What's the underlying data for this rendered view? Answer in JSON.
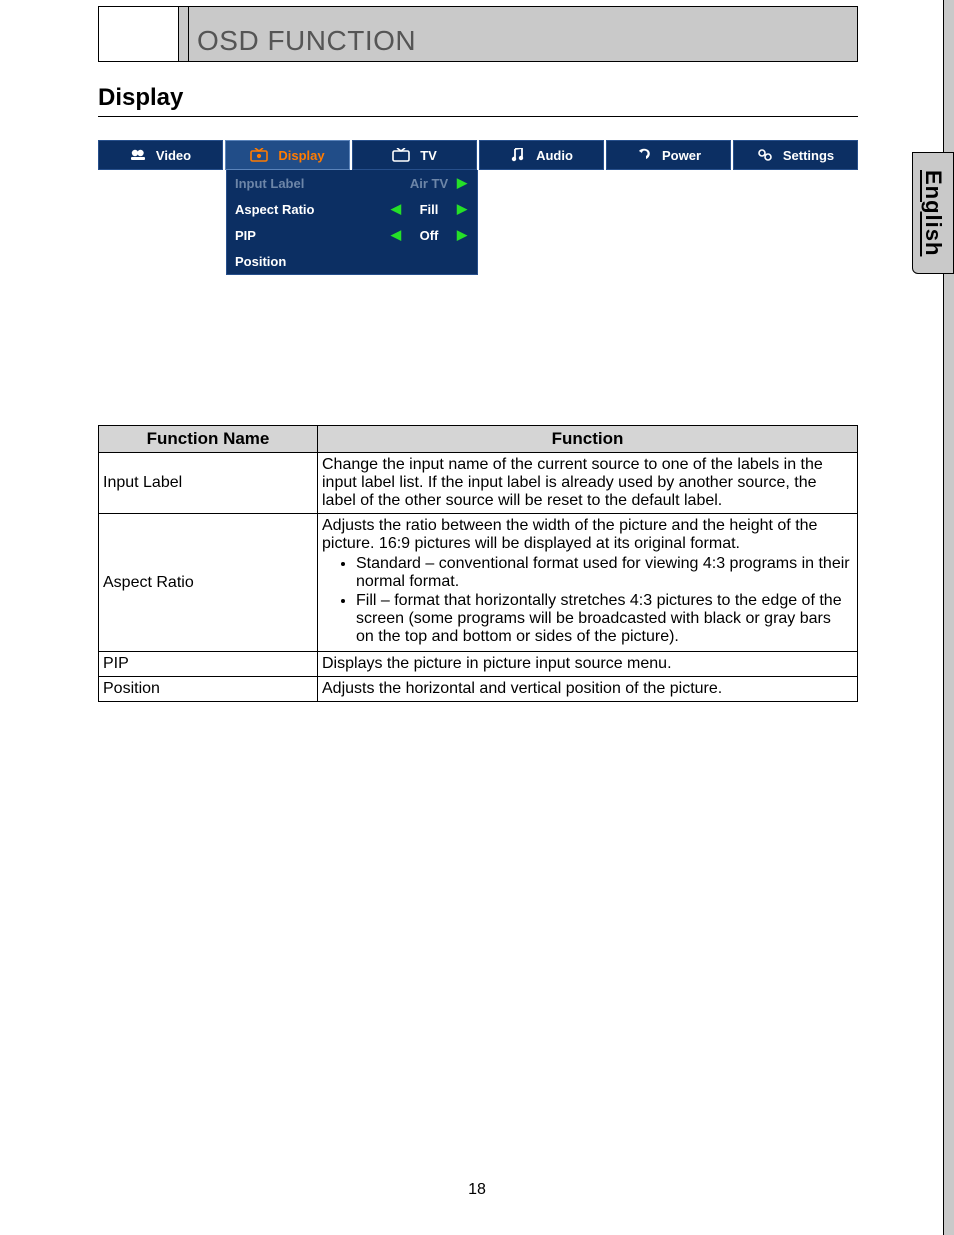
{
  "header": {
    "title": "OSD FUNCTION"
  },
  "section": {
    "heading": "Display"
  },
  "osd": {
    "tabs": [
      {
        "label": "Video",
        "icon": "video-icon"
      },
      {
        "label": "Display",
        "icon": "display-icon",
        "active": true
      },
      {
        "label": "TV",
        "icon": "tv-icon"
      },
      {
        "label": "Audio",
        "icon": "audio-icon"
      },
      {
        "label": "Power",
        "icon": "power-icon"
      },
      {
        "label": "Settings",
        "icon": "settings-icon"
      }
    ],
    "rows": [
      {
        "label": "Input Label",
        "value": "Air TV",
        "left": false,
        "right": true,
        "disabled": true
      },
      {
        "label": "Aspect Ratio",
        "value": "Fill",
        "left": true,
        "right": true
      },
      {
        "label": "PIP",
        "value": "Off",
        "left": true,
        "right": true
      },
      {
        "label": "Position",
        "value": "",
        "left": false,
        "right": false
      }
    ]
  },
  "table": {
    "head": {
      "name": "Function Name",
      "func": "Function"
    },
    "rows": [
      {
        "name": "Input Label",
        "desc": "Change the input name of the current source to one of the labels in the input label list. If the input label is already used by another source, the label of the other source will be reset to the default label."
      },
      {
        "name": "Aspect Ratio",
        "desc": "Adjusts the ratio between the width of the picture and the height of the picture. 16:9 pictures will be displayed at its original format.",
        "bullets": [
          "Standard – conventional format used for viewing 4:3 programs in their normal format.",
          "Fill – format that horizontally stretches 4:3 pictures to the edge of the screen (some programs will be broadcasted with black or gray bars on the top and bottom or sides of the picture)."
        ]
      },
      {
        "name": "PIP",
        "desc": "Displays the picture in picture input source menu."
      },
      {
        "name": "Position",
        "desc": "Adjusts the horizontal and vertical position of the picture."
      }
    ]
  },
  "side_tab": "English",
  "page_number": "18"
}
